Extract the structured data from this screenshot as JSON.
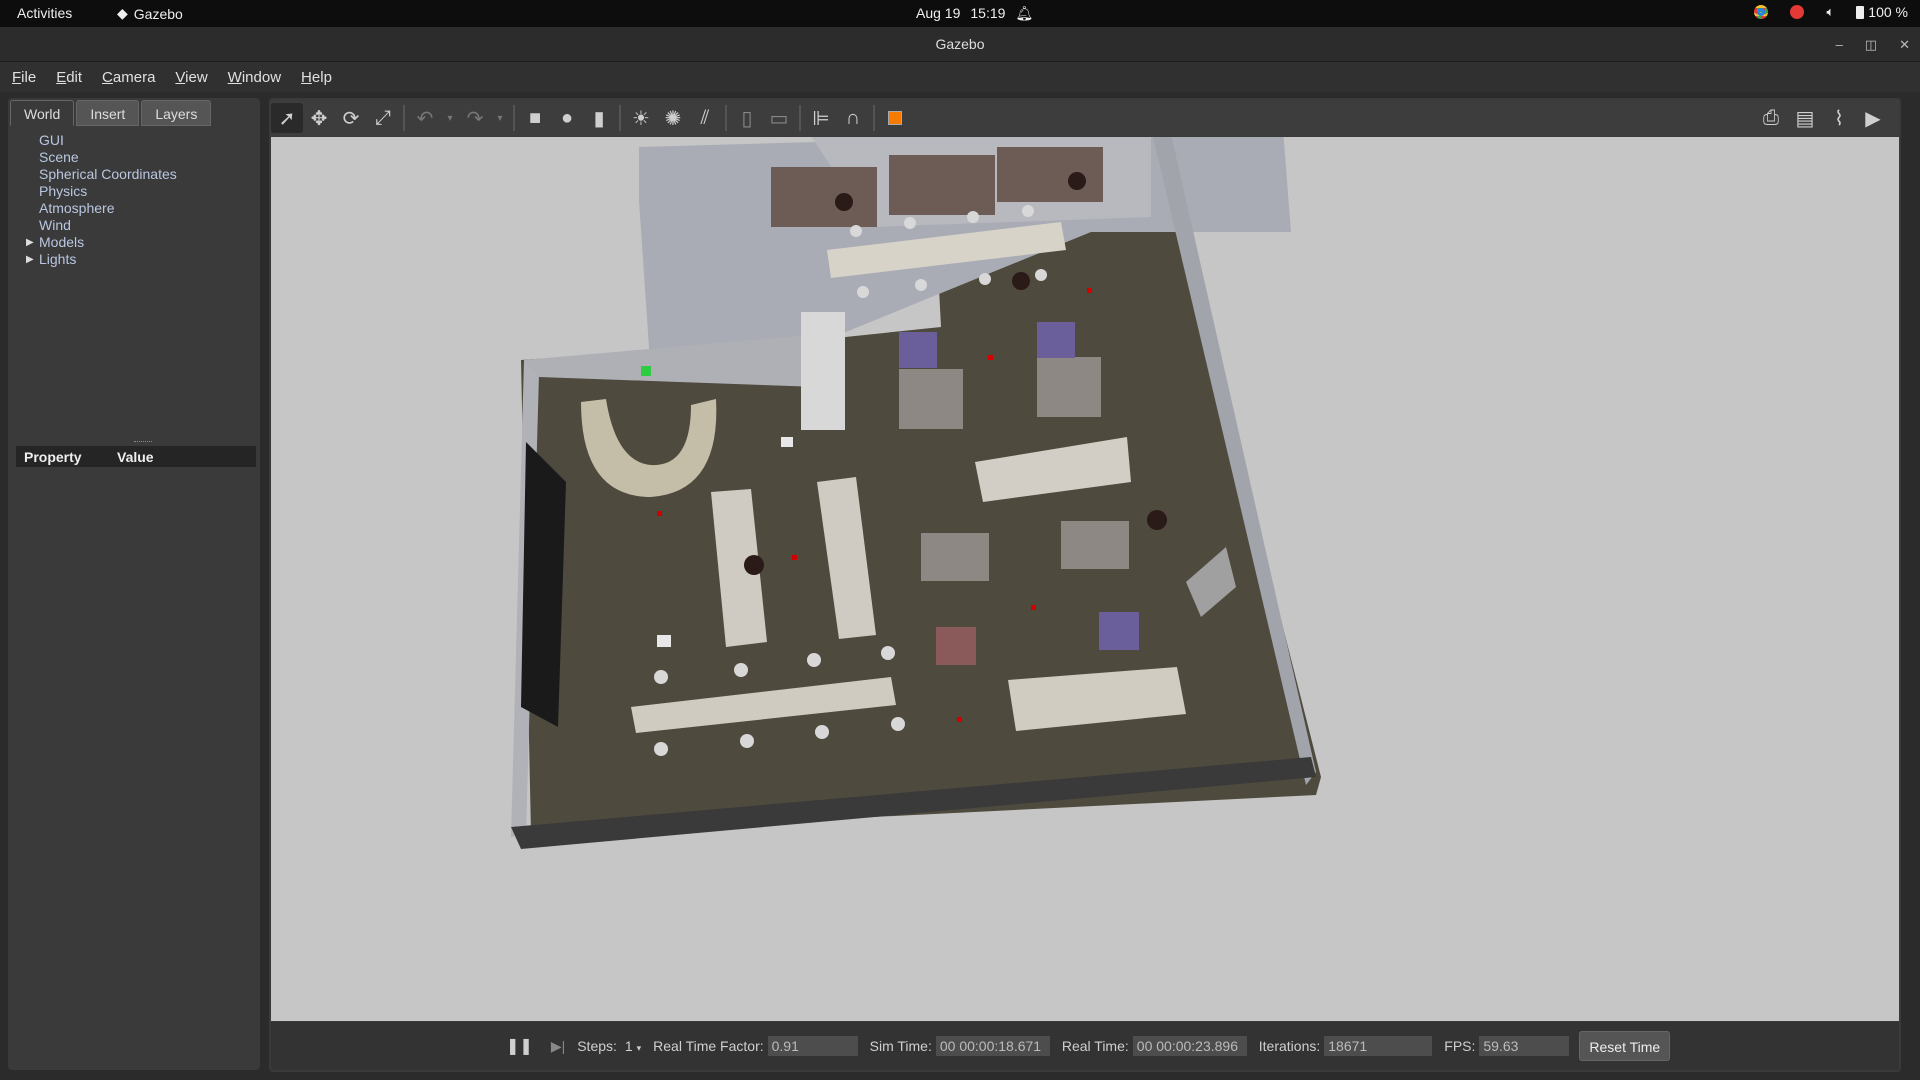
{
  "topbar": {
    "activities": "Activities",
    "app_name": "Gazebo",
    "date": "Aug 19",
    "time": "15:19",
    "battery": "100 %"
  },
  "window": {
    "title": "Gazebo"
  },
  "menu": {
    "file": "File",
    "edit": "Edit",
    "camera": "Camera",
    "view": "View",
    "window": "Window",
    "help": "Help"
  },
  "left_panel": {
    "tabs": [
      "World",
      "Insert",
      "Layers"
    ],
    "active_tab": "World",
    "tree": [
      "GUI",
      "Scene",
      "Spherical Coordinates",
      "Physics",
      "Atmosphere",
      "Wind",
      "Models",
      "Lights"
    ],
    "property_header": "Property",
    "value_header": "Value"
  },
  "toolbar": {
    "icons": [
      "select-mode-icon",
      "translate-mode-icon",
      "rotate-mode-icon",
      "scale-mode-icon",
      "undo-icon",
      "redo-icon",
      "box-icon",
      "sphere-icon",
      "cylinder-icon",
      "point-light-icon",
      "spot-light-icon",
      "directional-light-icon",
      "copy-icon",
      "paste-icon",
      "align-icon",
      "snap-icon",
      "view-angle-icon",
      "screenshot-icon",
      "log-icon",
      "plot-icon",
      "record-video-icon"
    ]
  },
  "bottom_bar": {
    "steps_label": "Steps:",
    "steps_value": "1",
    "rtf_label": "Real Time Factor:",
    "rtf_value": "0.91",
    "sim_time_label": "Sim Time:",
    "sim_time_value": "00 00:00:18.671",
    "real_time_label": "Real Time:",
    "real_time_value": "00 00:00:23.896",
    "iterations_label": "Iterations:",
    "iterations_value": "18671",
    "fps_label": "FPS:",
    "fps_value": "59.63",
    "reset_button": "Reset Time"
  },
  "colors": {
    "scene_background": "#c6c6c6",
    "floor": "#4f4a3e",
    "wall": "#b7b9bf"
  }
}
